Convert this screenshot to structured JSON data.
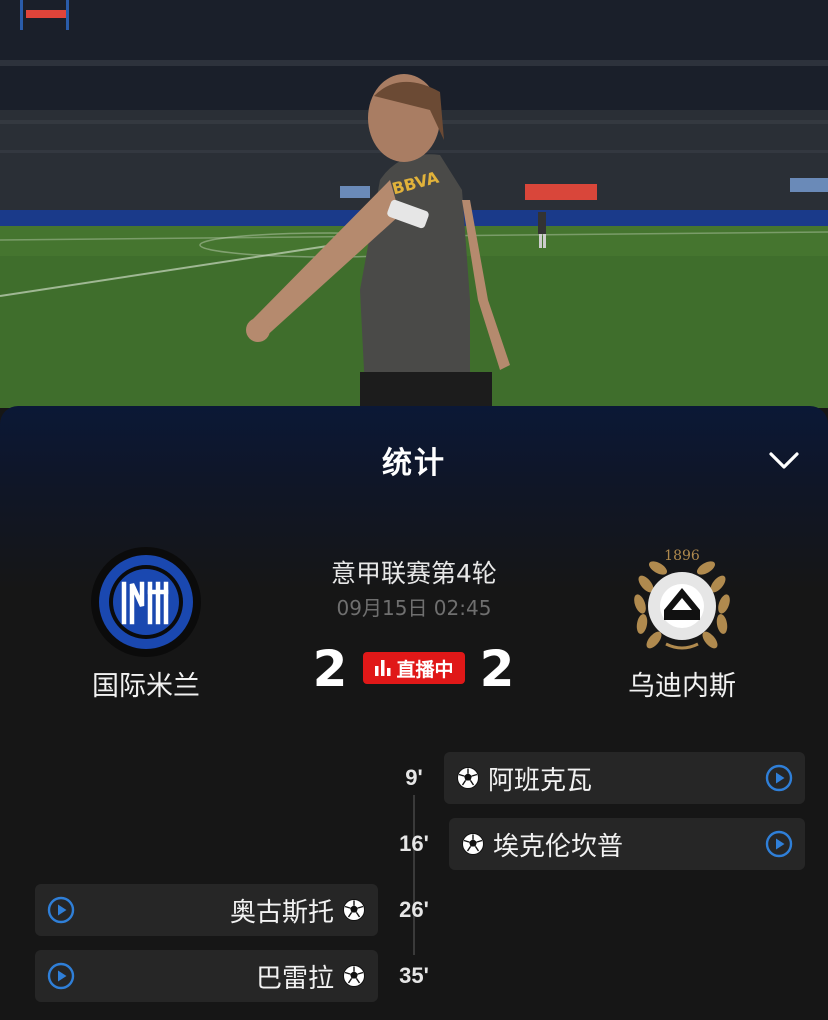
{
  "panel": {
    "title": "统计",
    "collapse_icon": "chevron-down-icon"
  },
  "match": {
    "league_round": "意甲联赛第4轮",
    "datetime": "09月15日 02:45",
    "home": {
      "name": "国际米兰",
      "score": "2",
      "logo": "inter-milan-logo"
    },
    "away": {
      "name": "乌迪内斯",
      "score": "2",
      "logo": "udinese-logo"
    },
    "live_label": "直播中",
    "colors": {
      "live": "#e01818",
      "play_icon": "#2f7fd8"
    }
  },
  "events": [
    {
      "minute": "9'",
      "player": "阿班克瓦",
      "side": "away"
    },
    {
      "minute": "16'",
      "player": "埃克伦坎普",
      "side": "away"
    },
    {
      "minute": "26'",
      "player": "奥古斯托",
      "side": "home"
    },
    {
      "minute": "35'",
      "player": "巴雷拉",
      "side": "home"
    }
  ]
}
